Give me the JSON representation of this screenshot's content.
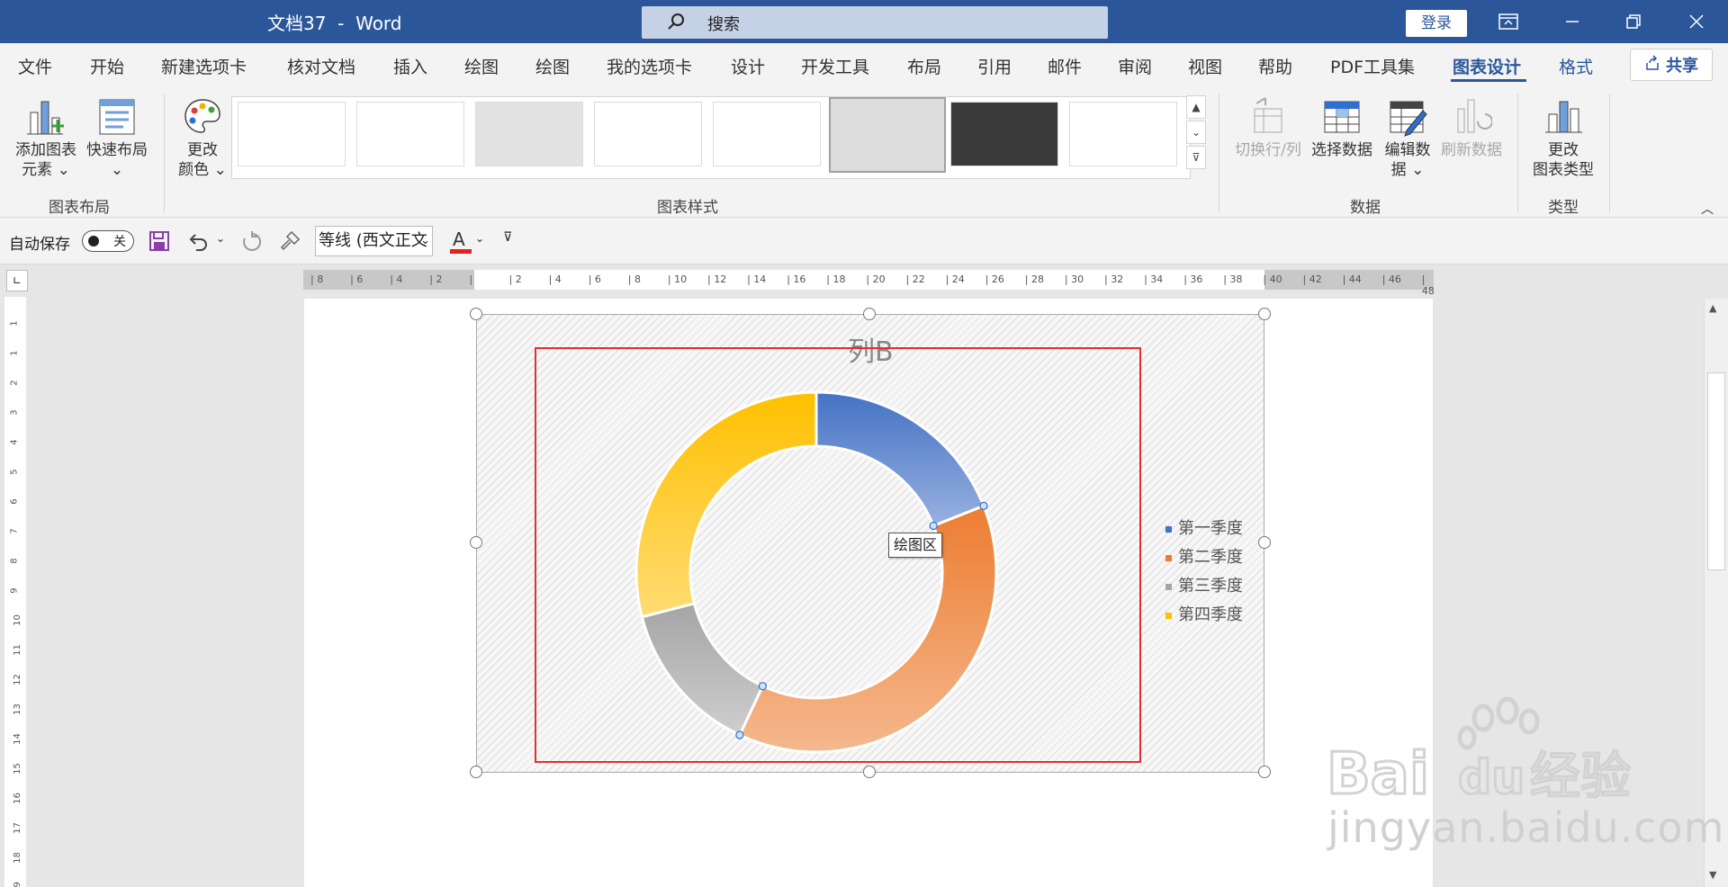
{
  "window": {
    "title": "文档37  -  Word",
    "search_placeholder": "搜索",
    "login": "登录"
  },
  "menu": {
    "items": [
      "文件",
      "开始",
      "新建选项卡",
      "核对文档",
      "插入",
      "绘图",
      "绘图",
      "我的选项卡",
      "设计",
      "开发工具",
      "布局",
      "引用",
      "邮件",
      "审阅",
      "视图",
      "帮助",
      "PDF工具集",
      "图表设计",
      "格式"
    ],
    "active_index": 17,
    "share": "共享"
  },
  "ribbon": {
    "add_chart_element": [
      "添加图表",
      "元素 ⌄"
    ],
    "quick_layout": [
      "快速布局",
      "⌄"
    ],
    "change_colors": [
      "更改",
      "颜色 ⌄"
    ],
    "switch_row_col": "切换行/列",
    "select_data": "选择数据",
    "edit_data": [
      "编辑数",
      "据 ⌄"
    ],
    "refresh_data": "刷新数据",
    "change_chart_type": [
      "更改",
      "图表类型"
    ],
    "groups": {
      "layout": "图表布局",
      "styles": "图表样式",
      "data": "数据",
      "type": "类型"
    }
  },
  "qat": {
    "autosave_label": "自动保存",
    "autosave_state": "关",
    "font_name": "等线 (西文正文"
  },
  "ruler": {
    "h_ticks": [
      "8",
      "6",
      "4",
      "2",
      "",
      "2",
      "4",
      "6",
      "8",
      "10",
      "12",
      "14",
      "16",
      "18",
      "20",
      "22",
      "24",
      "26",
      "28",
      "30",
      "32",
      "34",
      "36",
      "38",
      "40",
      "42",
      "44",
      "46",
      "48"
    ],
    "v_ticks": [
      "1",
      "1",
      "2",
      "3",
      "4",
      "5",
      "6",
      "7",
      "8",
      "9",
      "10",
      "11",
      "12",
      "13",
      "14",
      "15",
      "16",
      "17",
      "18",
      "19"
    ]
  },
  "chart_data": {
    "type": "pie",
    "variant": "doughnut",
    "title": "列B",
    "series": [
      {
        "name": "第一季度",
        "value": 19
      },
      {
        "name": "第二季度",
        "value": 38
      },
      {
        "name": "第三季度",
        "value": 14
      },
      {
        "name": "第四季度",
        "value": 29
      }
    ],
    "colors": [
      "#4472c4",
      "#ed7d31",
      "#a5a5a5",
      "#ffc000"
    ],
    "legend_position": "right"
  },
  "tooltip": "绘图区",
  "watermark": "jingyan.baidu.com"
}
